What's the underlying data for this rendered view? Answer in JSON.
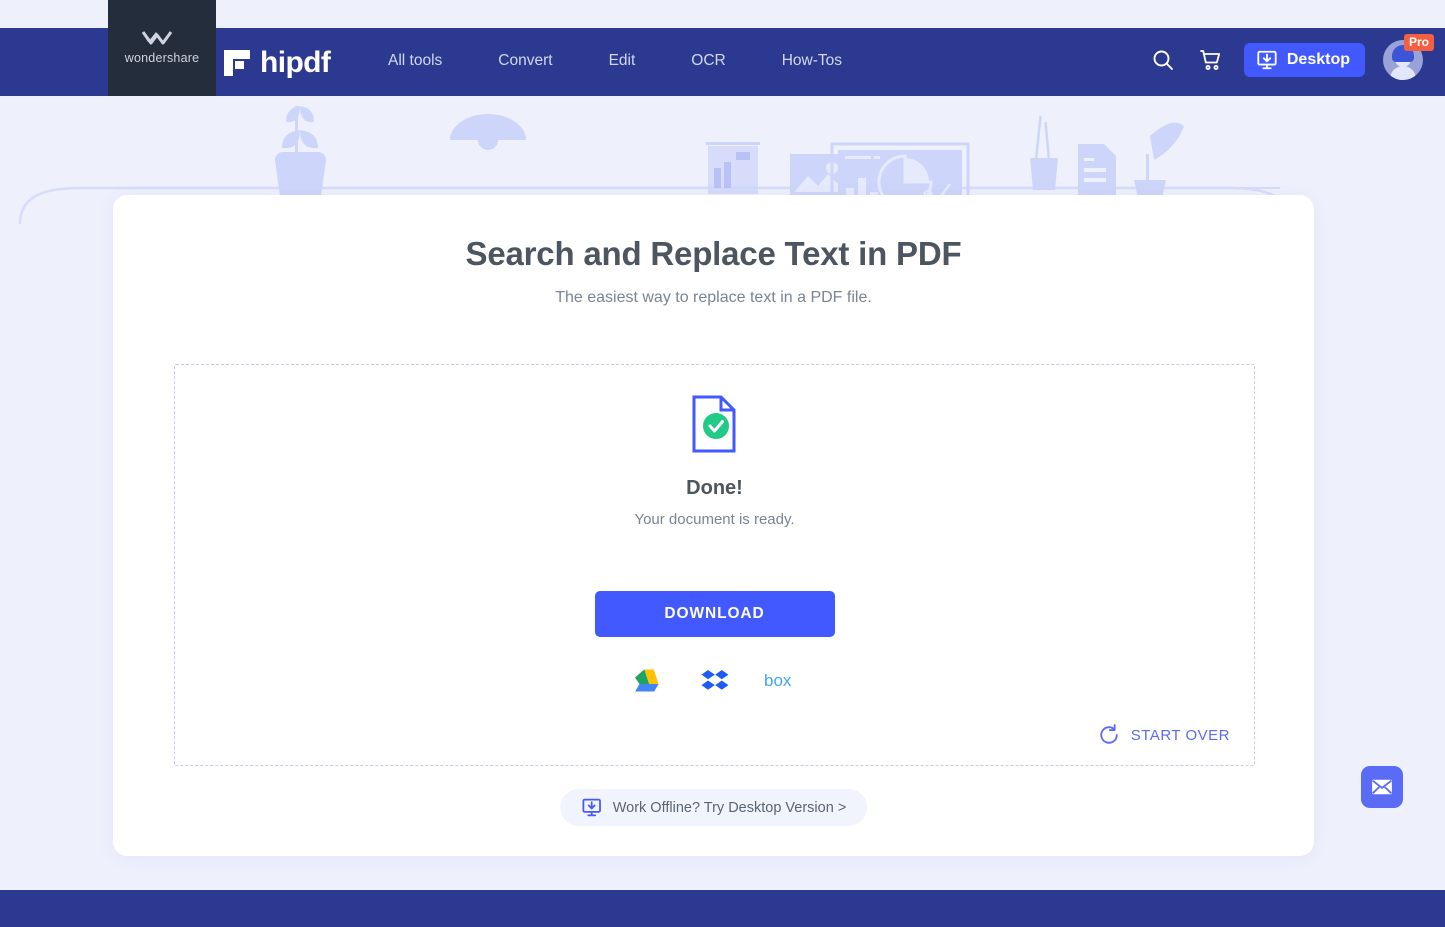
{
  "brand": {
    "vendor_name": "wondershare",
    "product_name": "hipdf",
    "vendor_mark_icon": "wondershare-logo-icon",
    "product_mark_icon": "hipdf-logo-icon"
  },
  "header": {
    "nav_items": [
      {
        "label": "All tools",
        "name": "nav-all-tools"
      },
      {
        "label": "Convert",
        "name": "nav-convert"
      },
      {
        "label": "Edit",
        "name": "nav-edit"
      },
      {
        "label": "OCR",
        "name": "nav-ocr"
      },
      {
        "label": "How-Tos",
        "name": "nav-how-tos"
      }
    ],
    "search_icon": "search-icon",
    "cart_icon": "shopping-cart-icon",
    "desktop_button": {
      "label": "Desktop",
      "icon": "monitor-download-icon"
    },
    "account": {
      "avatar_icon": "user-avatar-icon",
      "badge_label": "Pro"
    },
    "bar_color": "#2b3990",
    "vendor_block_color": "#242d3c"
  },
  "main": {
    "title": "Search and Replace Text in PDF",
    "subtitle": "The easiest way to replace text in a PDF file.",
    "result": {
      "document_icon": "document-check-icon",
      "status_heading": "Done!",
      "status_message": "Your document is ready.",
      "download_button_label": "DOWNLOAD",
      "download_button_color": "#4259ff",
      "cloud_targets": [
        {
          "label": "Google Drive",
          "icon": "google-drive-icon"
        },
        {
          "label": "Dropbox",
          "icon": "dropbox-icon"
        },
        {
          "label": "Box",
          "icon": "box-icon"
        }
      ],
      "start_over": {
        "label": "START OVER",
        "icon": "rotate-ccw-icon",
        "color": "#5a6bf5"
      }
    },
    "offline_pill": {
      "label": "Work Offline? Try Desktop Version >",
      "icon": "monitor-download-icon"
    }
  },
  "floating": {
    "mail_button": {
      "icon": "envelope-icon",
      "color": "#5a6bf5"
    }
  },
  "theme": {
    "page_background": "#eef0fc",
    "accent": "#4259ff",
    "text_dark": "#4d5560",
    "text_muted": "#7b8494",
    "decor_fill": "#ced5fa",
    "success_green": "#21ca87"
  }
}
